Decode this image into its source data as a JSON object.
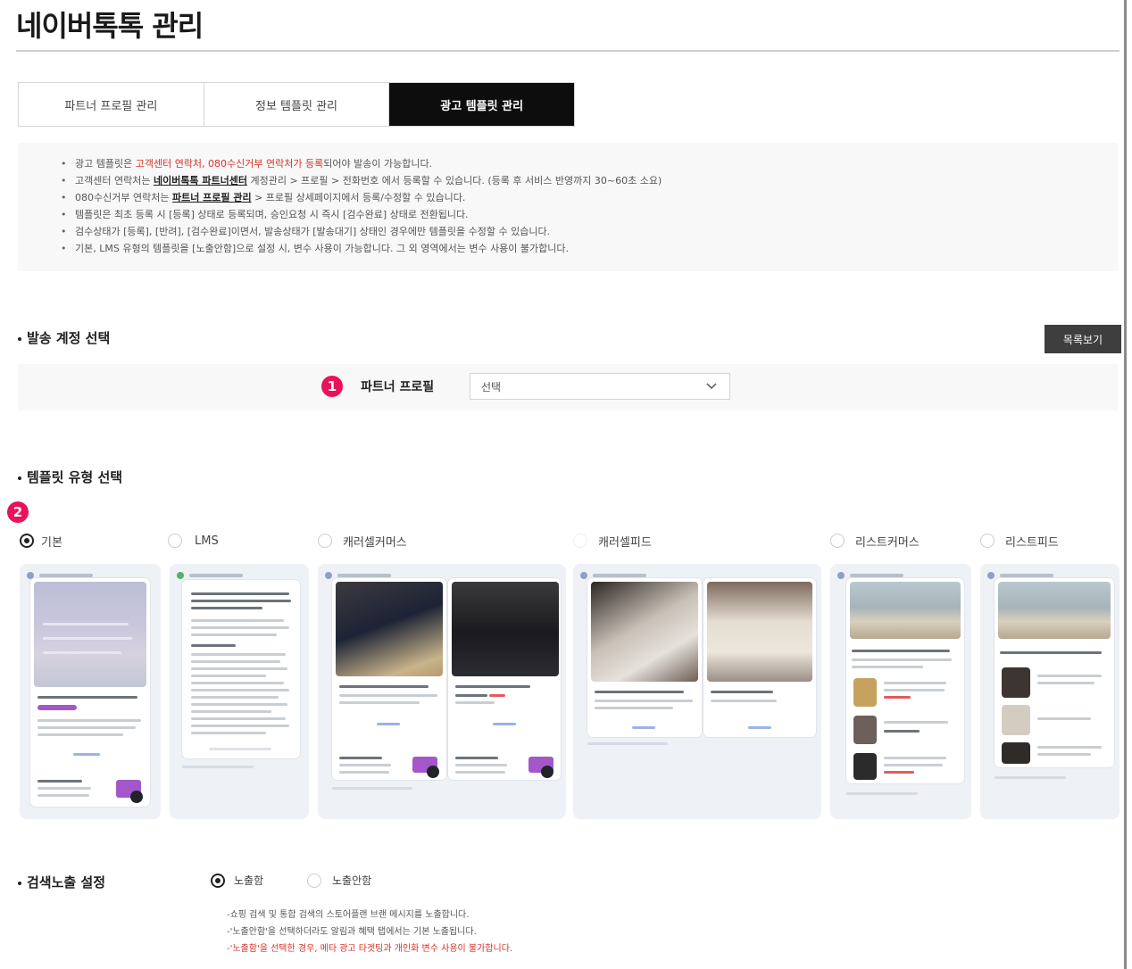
{
  "page": {
    "title": "네이버톡톡 관리"
  },
  "tabs": [
    {
      "label": "파트너 프로필 관리",
      "active": false
    },
    {
      "label": "정보 템플릿 관리",
      "active": false
    },
    {
      "label": "광고 템플릿 관리",
      "active": true
    }
  ],
  "notice": {
    "l1": {
      "a": "광고 템플릿은 ",
      "red": "고객센터 연락처, 080수신거부 연락처가 등록",
      "b": "되어야 발송이 가능합니다."
    },
    "l2": {
      "a": "고객센터 연락처는 ",
      "link": "네이버톡톡 파트너센터",
      "b": " 계정관리 > 프로필 > 전화번호 에서 등록할 수 있습니다. (등록 후 서비스 반영까지 30~60초 소요)"
    },
    "l3": {
      "a": "080수신거부 연락처는 ",
      "link": "파트너 프로필 관리",
      "b": " > 프로필 상세페이지에서 등록/수정할 수 있습니다."
    },
    "l4": "템플릿은 최초 등록 시 [등록] 상태로 등록되며, 승인요청 시 즉시 [검수완료] 상태로 전환됩니다.",
    "l5": "검수상태가 [등록], [반려], [검수완료]이면서, 발송상태가 [발송대기] 상태인 경우에만 템플릿을 수정할 수 있습니다.",
    "l6": "기본, LMS 유형의 템플릿을 [노출안함]으로 설정 시, 변수 사용이 가능합니다. 그 외 영역에서는 변수 사용이 불가합니다."
  },
  "send_account": {
    "heading": "발송 계정 선택",
    "list_button": "목록보기",
    "badge": "1",
    "field_label": "파트너 프로필",
    "select_value": "선택"
  },
  "template_type": {
    "heading": "템플릿 유형 선택",
    "badge": "2",
    "options": [
      {
        "label": "기본",
        "selected": true
      },
      {
        "label": "LMS",
        "selected": false
      },
      {
        "label": "캐러셀커머스",
        "selected": false
      },
      {
        "label": "캐러셀피드",
        "selected": false
      },
      {
        "label": "리스트커머스",
        "selected": false
      },
      {
        "label": "리스트피드",
        "selected": false
      }
    ]
  },
  "search_exposure": {
    "heading": "검색노출 설정",
    "options": [
      {
        "label": "노출함",
        "selected": true
      },
      {
        "label": "노출안함",
        "selected": false
      }
    ],
    "notes": [
      "-쇼핑 검색 및 통합 검색의 스토어플랜 브랜 메시지를 노출합니다.",
      "-'노출안함'을 선택하더라도 알림과 혜택 탭에서는 기본 노출됩니다.",
      "-'노출함'을 선택한 경우, 메타 광고 타겟팅과 개인화 변수 사용이 불가합니다."
    ]
  },
  "colors": {
    "accent_badge": "#e8135a",
    "active_tab": "#0d0d0d",
    "button_dark": "#3e3e3e",
    "notice_red": "#d8322a",
    "preview_purple": "#a357c9"
  },
  "icons": [
    "chevron-down-icon",
    "radio-icon",
    "number-badge-icon"
  ]
}
